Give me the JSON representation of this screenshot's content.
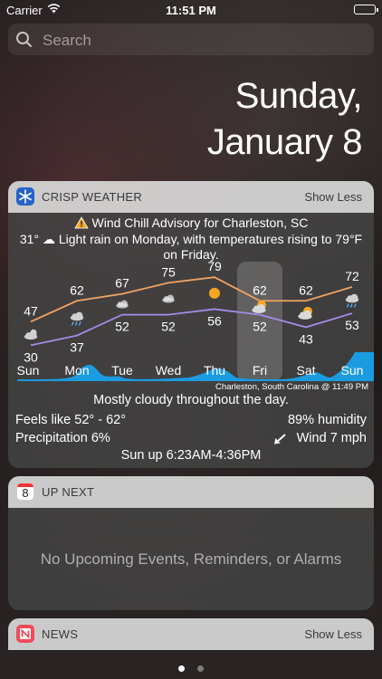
{
  "status_bar": {
    "carrier": "Carrier",
    "time": "11:51 PM"
  },
  "search": {
    "placeholder": "Search"
  },
  "date": {
    "line1": "Sunday,",
    "line2": "January 8"
  },
  "weather_widget": {
    "title": "CRISP WEATHER",
    "action": "Show Less",
    "advisory": "Wind Chill Advisory for Charleston, SC",
    "summary": "31° ☁ Light rain on Monday, with temperatures rising to 79°F on Friday.",
    "location_time": "Charleston, South Carolina @ 11:49 PM",
    "description": "Mostly cloudy throughout the day.",
    "feels_like": "Feels like 52° - 62°",
    "humidity": "89% humidity",
    "precipitation": "Precipitation 6%",
    "wind": "Wind 7 mph",
    "sun": "Sun up 6:23AM-4:36PM",
    "selected_day": "Fri",
    "forecast": [
      {
        "day": "Sun",
        "high": "47",
        "low": "30",
        "icon": "partly-cloudy-night-icon"
      },
      {
        "day": "Mon",
        "high": "62",
        "low": "37",
        "icon": "rain-cloud-icon"
      },
      {
        "day": "Tue",
        "high": "67",
        "low": "52",
        "icon": "cloud-icon"
      },
      {
        "day": "Wed",
        "high": "75",
        "low": "52",
        "icon": "cloud-icon"
      },
      {
        "day": "Thu",
        "high": "79",
        "low": "56",
        "icon": "sun-icon"
      },
      {
        "day": "Fri",
        "high": "62",
        "low": "52",
        "icon": "partly-cloudy-icon"
      },
      {
        "day": "Sat",
        "high": "62",
        "low": "43",
        "icon": "partly-cloudy-icon"
      },
      {
        "day": "Sun",
        "high": "72",
        "low": "53",
        "icon": "rain-cloud-icon"
      }
    ],
    "colors": {
      "high_line": "#f0a463",
      "low_line": "#a48be8",
      "precip": "#1b9be0",
      "sun": "#f5a623"
    }
  },
  "up_next_widget": {
    "title": "UP NEXT",
    "calendar_day": "8",
    "empty_message": "No Upcoming Events, Reminders, or Alarms"
  },
  "news_widget": {
    "title": "NEWS",
    "action": "Show Less"
  }
}
